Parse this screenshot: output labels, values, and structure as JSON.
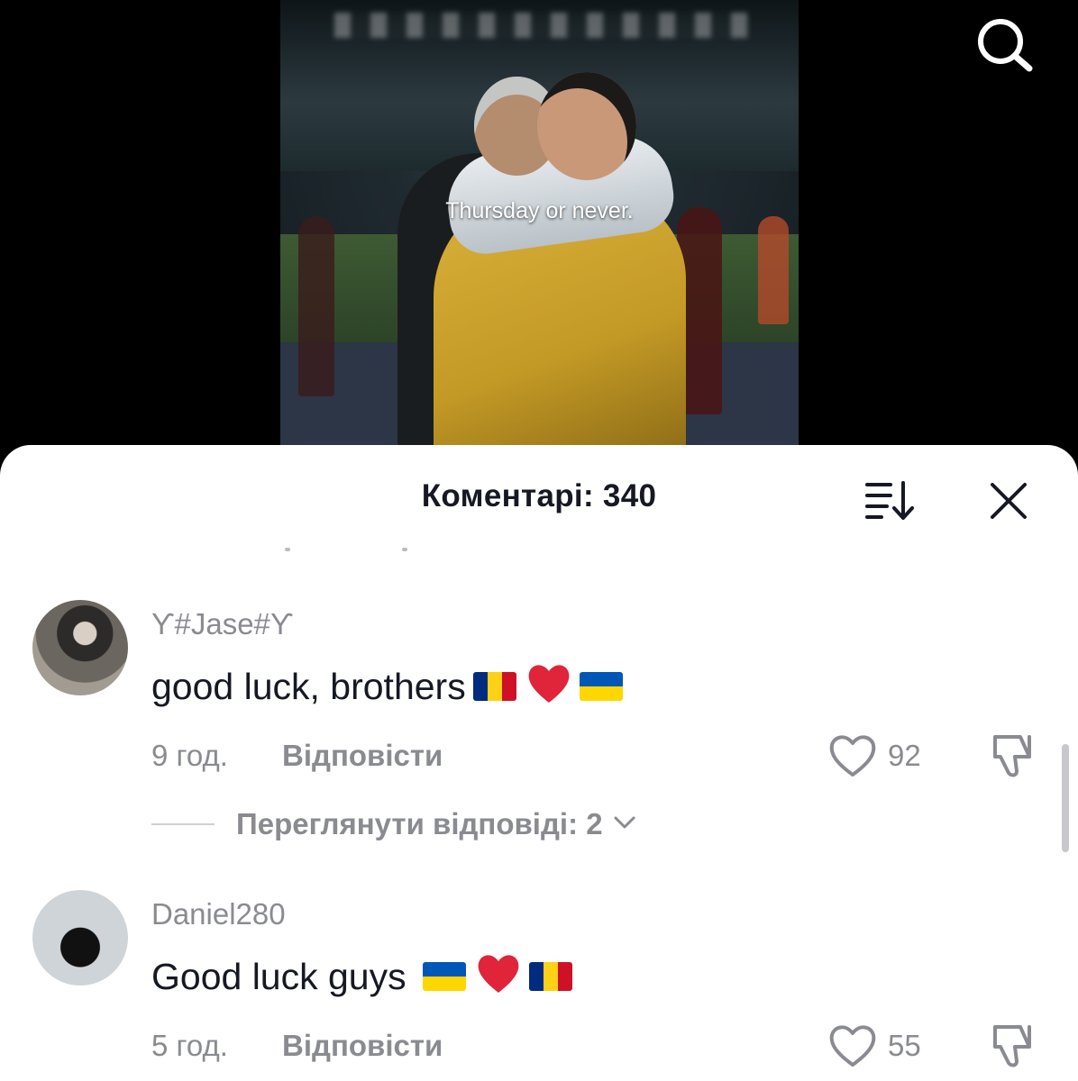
{
  "video": {
    "caption": "Thursday or never."
  },
  "comments_sheet": {
    "title": "Коментарі: 340",
    "comments": [
      {
        "username": "ϒ#Jase#ϒ",
        "text": "good luck, brothers",
        "emojis": [
          "flag-romania",
          "red-heart",
          "flag-ukraine"
        ],
        "time": "9 год.",
        "reply_label": "Відповісти",
        "likes": "92",
        "view_replies": "Переглянути відповіді: 2"
      },
      {
        "username": "Daniel280",
        "text": "Good luck guys",
        "emojis": [
          "flag-ukraine",
          "red-heart",
          "flag-romania"
        ],
        "time": "5 год.",
        "reply_label": "Відповісти",
        "likes": "55"
      }
    ]
  },
  "icons": {
    "search": "search-icon",
    "sort": "sort-icon",
    "close": "close-icon",
    "like": "heart-outline-icon",
    "dislike": "thumbs-down-icon"
  },
  "colors": {
    "heart": "#e0243a",
    "secondary_text": "#8a8b91",
    "primary_text": "#161823"
  }
}
